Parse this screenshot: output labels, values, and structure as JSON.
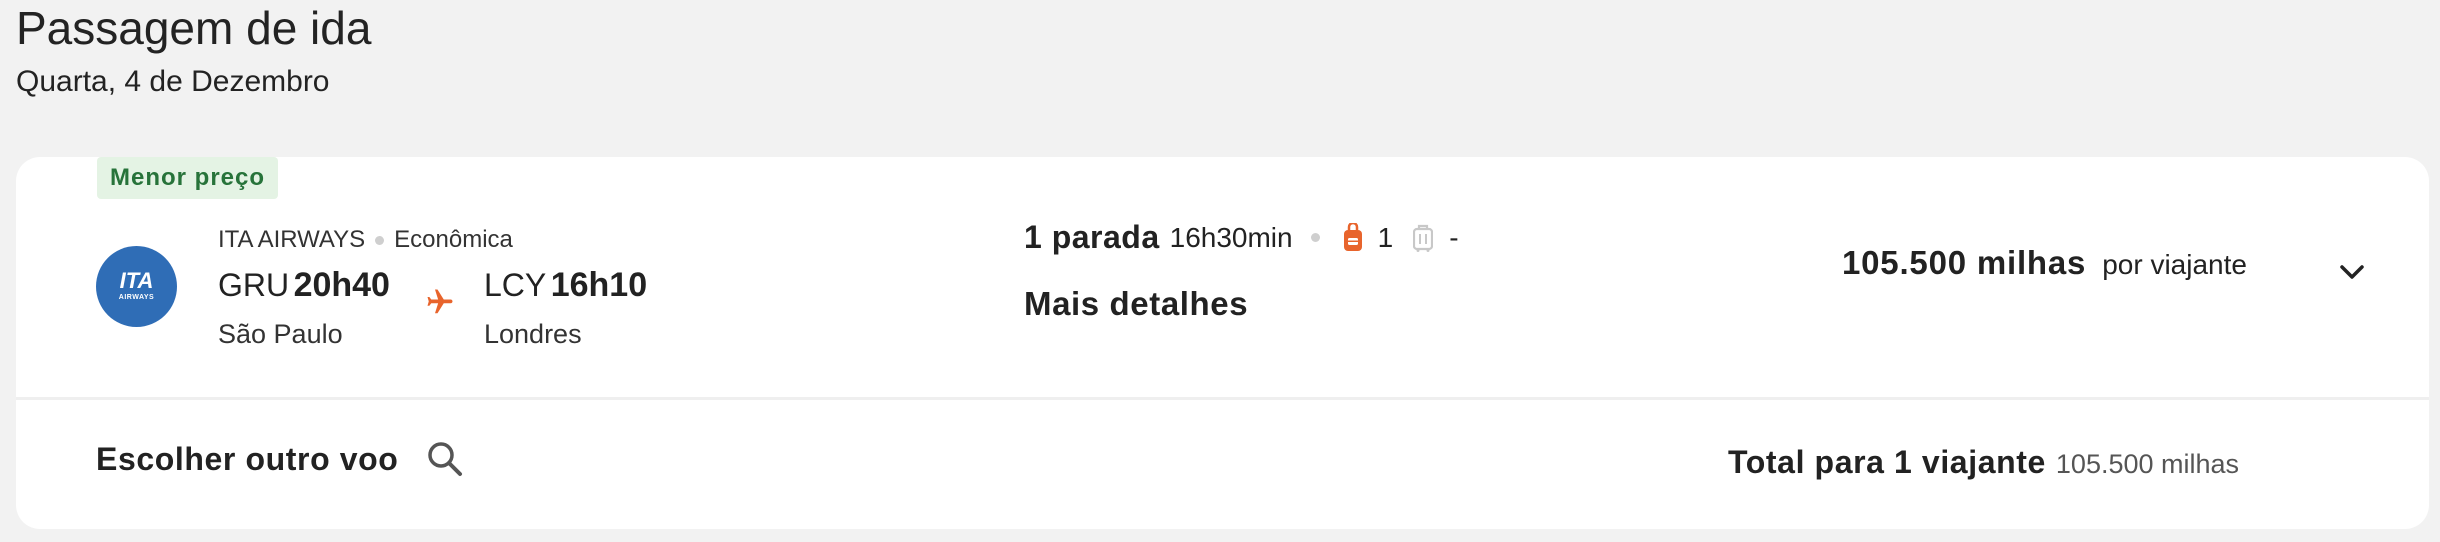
{
  "header": {
    "title": "Passagem de ida",
    "date": "Quarta, 4 de Dezembro"
  },
  "flight": {
    "badge": "Menor preço",
    "airline": {
      "name": "ITA AIRWAYS",
      "logo_text": "ITA",
      "logo_subtext": "AIRWAYS",
      "cabin": "Econômica"
    },
    "origin": {
      "code": "GRU",
      "time": "20h40",
      "city": "São Paulo"
    },
    "destination": {
      "code": "LCY",
      "time": "16h10",
      "city": "Londres"
    },
    "stops_label": "1 parada",
    "duration": "16h30min",
    "carry_on_count": "1",
    "checked_bag": "-",
    "more_details": "Mais detalhes",
    "price_miles": "105.500 milhas",
    "price_suffix": "por viajante"
  },
  "footer": {
    "choose_other": "Escolher outro voo",
    "total_label": "Total para 1 viajante",
    "total_value": "105.500 milhas"
  },
  "colors": {
    "accent_orange": "#e8642c",
    "badge_green": "#27733a",
    "logo_blue": "#2f6db6"
  },
  "icons": {
    "plane": "plane-icon",
    "carry_on": "backpack-icon",
    "checked": "suitcase-icon",
    "expand": "chevron-down-icon",
    "search": "search-icon"
  }
}
